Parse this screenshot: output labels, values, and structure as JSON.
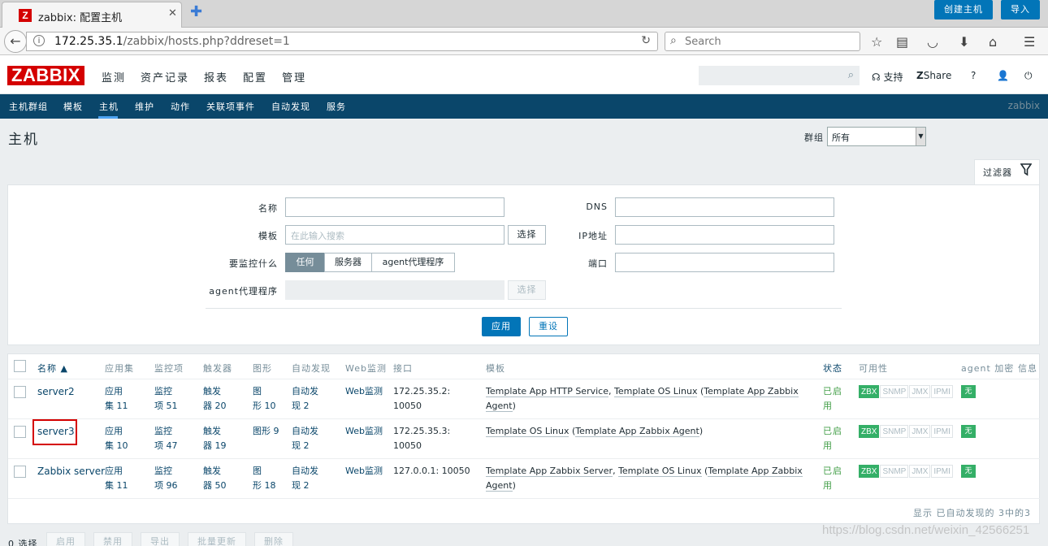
{
  "browser": {
    "tab_title": "zabbix: 配置主机",
    "tab_logo": "Z",
    "url_host": "172.25.35.1",
    "url_path": "/zabbix/hosts.php?ddreset=1",
    "search_placeholder": "Search"
  },
  "header": {
    "logo": "ZABBIX",
    "menu": [
      "监测",
      "资产记录",
      "报表",
      "配置",
      "管理"
    ],
    "support": "支持",
    "share": "Share",
    "help": "?"
  },
  "submenu": {
    "items": [
      "主机群组",
      "模板",
      "主机",
      "维护",
      "动作",
      "关联项事件",
      "自动发现",
      "服务"
    ],
    "brand": "zabbix"
  },
  "page": {
    "title": "主机",
    "group_label": "群组",
    "group_value": "所有",
    "create_button": "创建主机",
    "import_button": "导入"
  },
  "filter": {
    "tab_label": "过滤器",
    "name_label": "名称",
    "template_label": "模板",
    "template_placeholder": "在此输入搜索",
    "select_label": "选择",
    "monitor_label": "要监控什么",
    "monitor_options": [
      "任何",
      "服务器",
      "agent代理程序"
    ],
    "proxy_label": "agent代理程序",
    "dns_label": "DNS",
    "ip_label": "IP地址",
    "port_label": "端口",
    "apply": "应用",
    "reset": "重设"
  },
  "table": {
    "columns": [
      "名称 ▲",
      "应用集",
      "监控项",
      "触发器",
      "图形",
      "自动发现",
      "Web监测",
      "接口",
      "模板",
      "状态",
      "可用性",
      "agent 加密",
      "信息"
    ],
    "rows": [
      {
        "name": "server2",
        "apps": [
          "应用",
          "集 11"
        ],
        "items": [
          "监控",
          "项 51"
        ],
        "triggers": [
          "触发",
          "器 20"
        ],
        "graphs": [
          "图",
          "形 10"
        ],
        "discovery": [
          "自动发",
          "现 2"
        ],
        "web": "Web监测",
        "interface": [
          "172.25.35.2:",
          "10050"
        ],
        "templates": [
          {
            "text": "Template App HTTP Service",
            "link": true
          },
          {
            "text": ", ",
            "link": false
          },
          {
            "text": "Template OS Linux",
            "link": true
          },
          {
            "text": " (",
            "link": false
          },
          {
            "text": "Template App Zabbix Agent",
            "link": true
          },
          {
            "text": ")",
            "link": false
          }
        ],
        "status": [
          "已启",
          "用"
        ],
        "availability": [
          "ZBX",
          "SNMP",
          "JMX",
          "IPMI"
        ],
        "encryption": "无"
      },
      {
        "name": "server3",
        "apps": [
          "应用",
          "集 10"
        ],
        "items": [
          "监控",
          "项 47"
        ],
        "triggers": [
          "触发",
          "器 19"
        ],
        "graphs": [
          "图形 9",
          ""
        ],
        "discovery": [
          "自动发",
          "现 2"
        ],
        "web": "Web监测",
        "interface": [
          "172.25.35.3:",
          "10050"
        ],
        "templates": [
          {
            "text": "Template OS Linux",
            "link": true
          },
          {
            "text": " (",
            "link": false
          },
          {
            "text": "Template App Zabbix Agent",
            "link": true
          },
          {
            "text": ")",
            "link": false
          }
        ],
        "status": [
          "已启",
          "用"
        ],
        "availability": [
          "ZBX",
          "SNMP",
          "JMX",
          "IPMI"
        ],
        "encryption": "无"
      },
      {
        "name": "Zabbix server",
        "apps": [
          "应用",
          "集 11"
        ],
        "items": [
          "监控",
          "项 96"
        ],
        "triggers": [
          "触发",
          "器 50"
        ],
        "graphs": [
          "图",
          "形 18"
        ],
        "discovery": [
          "自动发",
          "现 2"
        ],
        "web": "Web监测",
        "interface": [
          "127.0.0.1: 10050",
          ""
        ],
        "templates": [
          {
            "text": "Template App Zabbix Server",
            "link": true
          },
          {
            "text": ", ",
            "link": false
          },
          {
            "text": "Template OS Linux",
            "link": true
          },
          {
            "text": " (",
            "link": false
          },
          {
            "text": "Template App Zabbix Agent",
            "link": true
          },
          {
            "text": ")",
            "link": false
          }
        ],
        "status": [
          "已启",
          "用"
        ],
        "availability": [
          "ZBX",
          "SNMP",
          "JMX",
          "IPMI"
        ],
        "encryption": "无"
      }
    ],
    "footer": "显示 已自动发现的 3中的3"
  },
  "actions": {
    "count": "0 选择",
    "buttons": [
      "启用",
      "禁用",
      "导出",
      "批量更新",
      "删除"
    ]
  },
  "watermark": "https://blog.csdn.net/weixin_42566251"
}
